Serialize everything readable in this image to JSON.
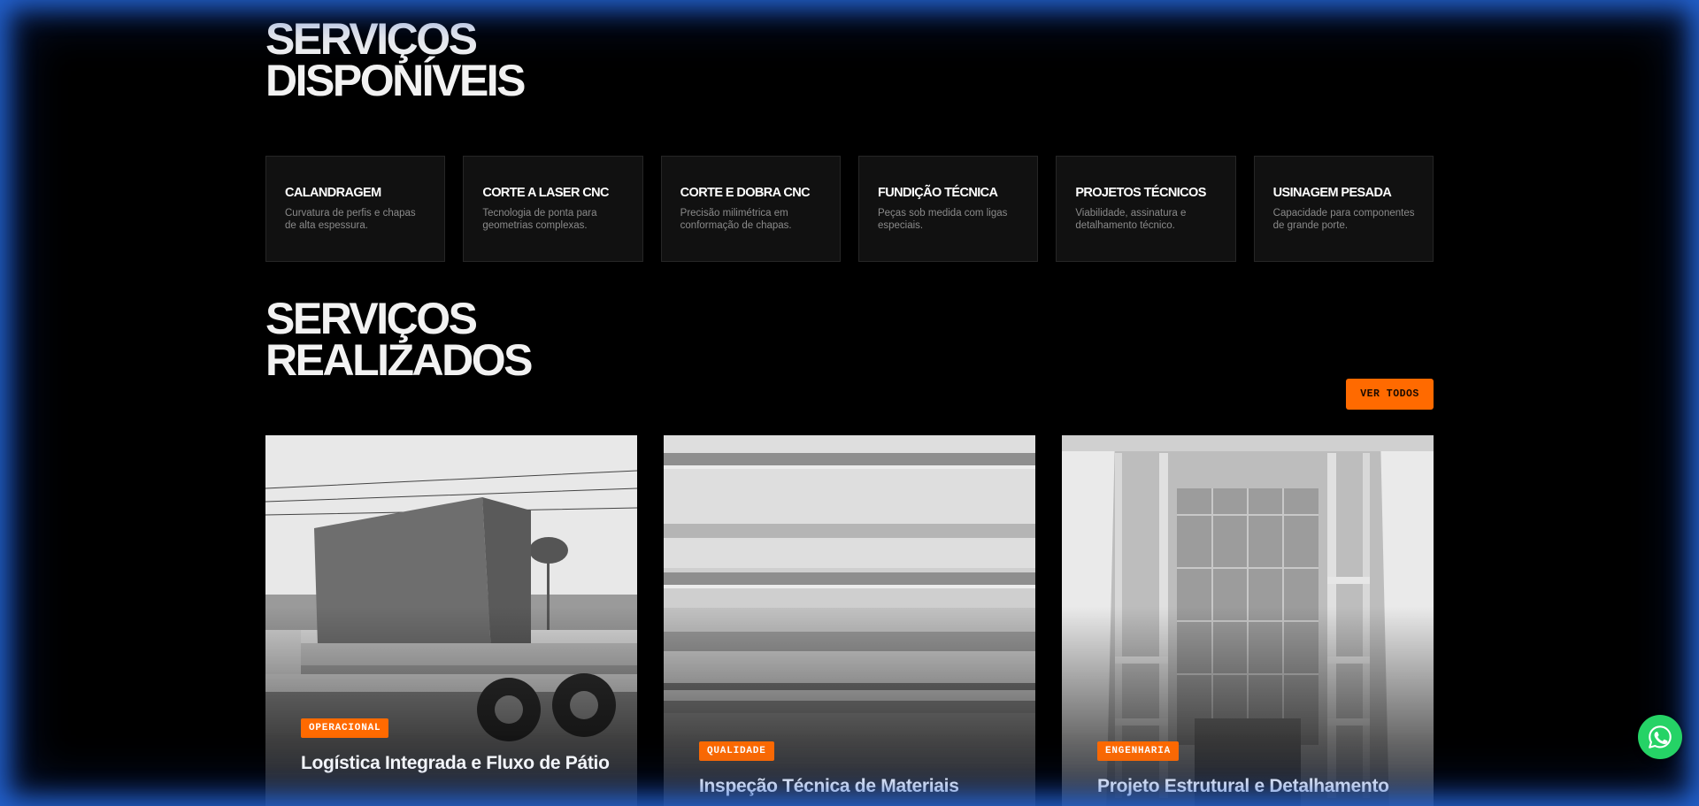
{
  "available_services": {
    "title_line1": "SERVIÇOS",
    "title_line2": "DISPONÍVEIS",
    "items": [
      {
        "title": "CALANDRAGEM",
        "description": "Curvatura de perfis e chapas de alta espessura."
      },
      {
        "title": "CORTE A LASER CNC",
        "description": "Tecnologia de ponta para geometrias complexas."
      },
      {
        "title": "CORTE E DOBRA CNC",
        "description": "Precisão milimétrica em conformação de chapas."
      },
      {
        "title": "FUNDIÇÃO TÉCNICA",
        "description": "Peças sob medida com ligas especiais."
      },
      {
        "title": "PROJETOS TÉCNICOS",
        "description": "Viabilidade, assinatura e detalhamento técnico."
      },
      {
        "title": "USINAGEM PESADA",
        "description": "Capacidade para componentes de grande porte."
      }
    ]
  },
  "completed_services": {
    "title_line1": "SERVIÇOS",
    "title_line2": "REALIZADOS",
    "view_all_label": "VER TODOS",
    "projects": [
      {
        "tag": "OPERACIONAL",
        "title": "Logística Integrada e Fluxo de Pátio"
      },
      {
        "tag": "QUALIDADE",
        "title": "Inspeção Técnica de Materiais"
      },
      {
        "tag": "ENGENHARIA",
        "title": "Projeto Estrutural e Detalhamento"
      }
    ]
  },
  "icons": {
    "whatsapp": "whatsapp-icon"
  },
  "colors": {
    "accent": "#ff6a00",
    "background": "#000000",
    "card_background": "#111111",
    "whatsapp": "#25d366"
  }
}
